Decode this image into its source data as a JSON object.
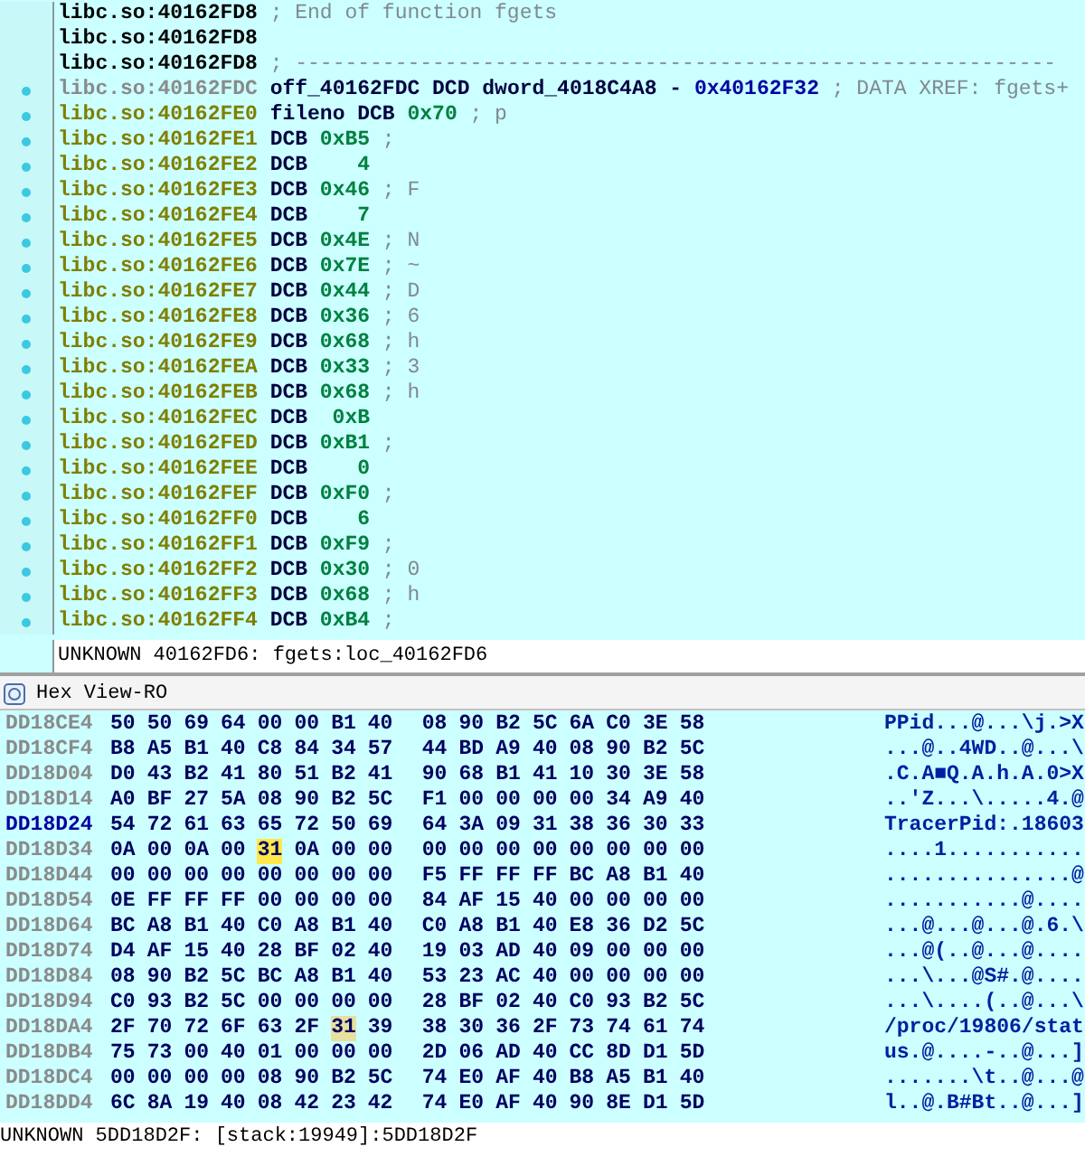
{
  "disassembly": {
    "lines": [
      {
        "addr": "libc.so:40162FD8",
        "color": "#000000",
        "dot": false,
        "tokens": [
          {
            "text": "; End of function fgets",
            "kind": "comment"
          }
        ]
      },
      {
        "addr": "libc.so:40162FD8",
        "color": "#000000",
        "dot": false
      },
      {
        "addr": "libc.so:40162FD8",
        "color": "#000000",
        "dot": false,
        "tokens": [
          {
            "text": "; -------------------------------------------------------------",
            "kind": "comment"
          }
        ]
      },
      {
        "addr": "libc.so:40162FDC",
        "color": "#8a8a8a",
        "dot": true,
        "tokens": [
          {
            "text": "off_40162FDC",
            "kind": "name"
          },
          {
            "text": "DCD",
            "kind": "keyword"
          },
          {
            "text": "dword_4018C4A8",
            "kind": "name"
          },
          {
            "text": "-",
            "kind": "name"
          },
          {
            "text": "0x40162F32",
            "kind": "address"
          },
          {
            "text": "; DATA XREF: fgets+",
            "kind": "comment"
          }
        ]
      },
      {
        "addr": "libc.so:40162FE0",
        "color": "#7f7f00",
        "dot": true,
        "tokens": [
          {
            "text": "fileno",
            "kind": "name"
          },
          {
            "text": "DCB",
            "kind": "keyword"
          },
          {
            "text": "0x70",
            "kind": "number"
          },
          {
            "text": "; p",
            "kind": "comment"
          }
        ]
      },
      {
        "addr": "libc.so:40162FE1",
        "color": "#7f7f00",
        "dot": true,
        "tokens": [
          {
            "text": "DCB",
            "kind": "keyword"
          },
          {
            "text": "0xB5",
            "kind": "number"
          },
          {
            "text": ";",
            "kind": "comment"
          }
        ]
      },
      {
        "addr": "libc.so:40162FE2",
        "color": "#7f7f00",
        "dot": true,
        "tokens": [
          {
            "text": "DCB",
            "kind": "keyword"
          },
          {
            "text": "4",
            "kind": "number"
          }
        ]
      },
      {
        "addr": "libc.so:40162FE3",
        "color": "#7f7f00",
        "dot": true,
        "tokens": [
          {
            "text": "DCB",
            "kind": "keyword"
          },
          {
            "text": "0x46",
            "kind": "number"
          },
          {
            "text": "; F",
            "kind": "comment"
          }
        ]
      },
      {
        "addr": "libc.so:40162FE4",
        "color": "#7f7f00",
        "dot": true,
        "tokens": [
          {
            "text": "DCB",
            "kind": "keyword"
          },
          {
            "text": "7",
            "kind": "number"
          }
        ]
      },
      {
        "addr": "libc.so:40162FE5",
        "color": "#7f7f00",
        "dot": true,
        "tokens": [
          {
            "text": "DCB",
            "kind": "keyword"
          },
          {
            "text": "0x4E",
            "kind": "number"
          },
          {
            "text": "; N",
            "kind": "comment"
          }
        ]
      },
      {
        "addr": "libc.so:40162FE6",
        "color": "#7f7f00",
        "dot": true,
        "tokens": [
          {
            "text": "DCB",
            "kind": "keyword"
          },
          {
            "text": "0x7E",
            "kind": "number"
          },
          {
            "text": "; ~",
            "kind": "comment"
          }
        ]
      },
      {
        "addr": "libc.so:40162FE7",
        "color": "#7f7f00",
        "dot": true,
        "tokens": [
          {
            "text": "DCB",
            "kind": "keyword"
          },
          {
            "text": "0x44",
            "kind": "number"
          },
          {
            "text": "; D",
            "kind": "comment"
          }
        ]
      },
      {
        "addr": "libc.so:40162FE8",
        "color": "#7f7f00",
        "dot": true,
        "tokens": [
          {
            "text": "DCB",
            "kind": "keyword"
          },
          {
            "text": "0x36",
            "kind": "number"
          },
          {
            "text": "; 6",
            "kind": "comment"
          }
        ]
      },
      {
        "addr": "libc.so:40162FE9",
        "color": "#7f7f00",
        "dot": true,
        "tokens": [
          {
            "text": "DCB",
            "kind": "keyword"
          },
          {
            "text": "0x68",
            "kind": "number"
          },
          {
            "text": "; h",
            "kind": "comment"
          }
        ]
      },
      {
        "addr": "libc.so:40162FEA",
        "color": "#7f7f00",
        "dot": true,
        "tokens": [
          {
            "text": "DCB",
            "kind": "keyword"
          },
          {
            "text": "0x33",
            "kind": "number"
          },
          {
            "text": "; 3",
            "kind": "comment"
          }
        ]
      },
      {
        "addr": "libc.so:40162FEB",
        "color": "#7f7f00",
        "dot": true,
        "tokens": [
          {
            "text": "DCB",
            "kind": "keyword"
          },
          {
            "text": "0x68",
            "kind": "number"
          },
          {
            "text": "; h",
            "kind": "comment"
          }
        ]
      },
      {
        "addr": "libc.so:40162FEC",
        "color": "#7f7f00",
        "dot": true,
        "tokens": [
          {
            "text": "DCB",
            "kind": "keyword"
          },
          {
            "text": "0xB",
            "kind": "number"
          }
        ]
      },
      {
        "addr": "libc.so:40162FED",
        "color": "#7f7f00",
        "dot": true,
        "tokens": [
          {
            "text": "DCB",
            "kind": "keyword"
          },
          {
            "text": "0xB1",
            "kind": "number"
          },
          {
            "text": ";",
            "kind": "comment"
          }
        ]
      },
      {
        "addr": "libc.so:40162FEE",
        "color": "#7f7f00",
        "dot": true,
        "tokens": [
          {
            "text": "DCB",
            "kind": "keyword"
          },
          {
            "text": "0",
            "kind": "number"
          }
        ]
      },
      {
        "addr": "libc.so:40162FEF",
        "color": "#7f7f00",
        "dot": true,
        "tokens": [
          {
            "text": "DCB",
            "kind": "keyword"
          },
          {
            "text": "0xF0",
            "kind": "number"
          },
          {
            "text": ";",
            "kind": "comment"
          }
        ]
      },
      {
        "addr": "libc.so:40162FF0",
        "color": "#7f7f00",
        "dot": true,
        "tokens": [
          {
            "text": "DCB",
            "kind": "keyword"
          },
          {
            "text": "6",
            "kind": "number"
          }
        ]
      },
      {
        "addr": "libc.so:40162FF1",
        "color": "#7f7f00",
        "dot": true,
        "tokens": [
          {
            "text": "DCB",
            "kind": "keyword"
          },
          {
            "text": "0xF9",
            "kind": "number"
          },
          {
            "text": ";",
            "kind": "comment"
          }
        ]
      },
      {
        "addr": "libc.so:40162FF2",
        "color": "#7f7f00",
        "dot": true,
        "tokens": [
          {
            "text": "DCB",
            "kind": "keyword"
          },
          {
            "text": "0x30",
            "kind": "number"
          },
          {
            "text": "; 0",
            "kind": "comment"
          }
        ]
      },
      {
        "addr": "libc.so:40162FF3",
        "color": "#7f7f00",
        "dot": true,
        "tokens": [
          {
            "text": "DCB",
            "kind": "keyword"
          },
          {
            "text": "0x68",
            "kind": "number"
          },
          {
            "text": "; h",
            "kind": "comment"
          }
        ]
      },
      {
        "addr": "libc.so:40162FF4",
        "color": "#7f7f00",
        "dot": true,
        "tokens": [
          {
            "text": "DCB",
            "kind": "keyword"
          },
          {
            "text": "0xB4",
            "kind": "number"
          },
          {
            "text": ";",
            "kind": "comment"
          }
        ]
      }
    ],
    "status": "UNKNOWN 40162FD6: fgets:loc_40162FD6"
  },
  "hex_view": {
    "title": "Hex View-RO",
    "rows": [
      {
        "addr": "DD18CE4",
        "current": false,
        "bytes": [
          "50",
          "50",
          "69",
          "64",
          "00",
          "00",
          "B1",
          "40",
          "08",
          "90",
          "B2",
          "5C",
          "6A",
          "C0",
          "3E",
          "58"
        ],
        "ascii": "PPid...@...\\j.>X"
      },
      {
        "addr": "DD18CF4",
        "current": false,
        "bytes": [
          "B8",
          "A5",
          "B1",
          "40",
          "C8",
          "84",
          "34",
          "57",
          "44",
          "BD",
          "A9",
          "40",
          "08",
          "90",
          "B2",
          "5C"
        ],
        "ascii": "...@..4WD..@...\\"
      },
      {
        "addr": "DD18D04",
        "current": false,
        "bytes": [
          "D0",
          "43",
          "B2",
          "41",
          "80",
          "51",
          "B2",
          "41",
          "90",
          "68",
          "B1",
          "41",
          "10",
          "30",
          "3E",
          "58"
        ],
        "ascii": ".C.A■Q.A.h.A.0>X"
      },
      {
        "addr": "DD18D14",
        "current": false,
        "bytes": [
          "A0",
          "BF",
          "27",
          "5A",
          "08",
          "90",
          "B2",
          "5C",
          "F1",
          "00",
          "00",
          "00",
          "00",
          "34",
          "A9",
          "40"
        ],
        "ascii": "..'Z...\\.....4.@"
      },
      {
        "addr": "DD18D24",
        "current": true,
        "bytes": [
          "54",
          "72",
          "61",
          "63",
          "65",
          "72",
          "50",
          "69",
          "64",
          "3A",
          "09",
          "31",
          "38",
          "36",
          "30",
          "33"
        ],
        "ascii": "TracerPid:.18603"
      },
      {
        "addr": "DD18D34",
        "current": false,
        "bytes": [
          "0A",
          "00",
          "0A",
          "00",
          {
            "text": "31",
            "color": "#ffe84a"
          },
          "0A",
          "00",
          "00",
          "00",
          "00",
          "00",
          "00",
          "00",
          "00",
          "00",
          "00"
        ],
        "ascii": "....1..........."
      },
      {
        "addr": "DD18D44",
        "current": false,
        "bytes": [
          "00",
          "00",
          "00",
          "00",
          "00",
          "00",
          "00",
          "00",
          "F5",
          "FF",
          "FF",
          "FF",
          "BC",
          "A8",
          "B1",
          "40"
        ],
        "ascii": "...............@"
      },
      {
        "addr": "DD18D54",
        "current": false,
        "bytes": [
          "0E",
          "FF",
          "FF",
          "FF",
          "00",
          "00",
          "00",
          "00",
          "84",
          "AF",
          "15",
          "40",
          "00",
          "00",
          "00",
          "00"
        ],
        "ascii": "...........@...."
      },
      {
        "addr": "DD18D64",
        "current": false,
        "bytes": [
          "BC",
          "A8",
          "B1",
          "40",
          "C0",
          "A8",
          "B1",
          "40",
          "C0",
          "A8",
          "B1",
          "40",
          "E8",
          "36",
          "D2",
          "5C"
        ],
        "ascii": "...@...@...@.6.\\"
      },
      {
        "addr": "DD18D74",
        "current": false,
        "bytes": [
          "D4",
          "AF",
          "15",
          "40",
          "28",
          "BF",
          "02",
          "40",
          "19",
          "03",
          "AD",
          "40",
          "09",
          "00",
          "00",
          "00"
        ],
        "ascii": "...@(..@...@...."
      },
      {
        "addr": "DD18D84",
        "current": false,
        "bytes": [
          "08",
          "90",
          "B2",
          "5C",
          "BC",
          "A8",
          "B1",
          "40",
          "53",
          "23",
          "AC",
          "40",
          "00",
          "00",
          "00",
          "00"
        ],
        "ascii": "...\\...@S#.@...."
      },
      {
        "addr": "DD18D94",
        "current": false,
        "bytes": [
          "C0",
          "93",
          "B2",
          "5C",
          "00",
          "00",
          "00",
          "00",
          "28",
          "BF",
          "02",
          "40",
          "C0",
          "93",
          "B2",
          "5C"
        ],
        "ascii": "...\\....(..@...\\"
      },
      {
        "addr": "DD18DA4",
        "current": false,
        "bytes": [
          "2F",
          "70",
          "72",
          "6F",
          "63",
          "2F",
          {
            "text": "31",
            "color": "#e8e0a0"
          },
          "39",
          "38",
          "30",
          "36",
          "2F",
          "73",
          "74",
          "61",
          "74"
        ],
        "ascii": "/proc/19806/stat"
      },
      {
        "addr": "DD18DB4",
        "current": false,
        "bytes": [
          "75",
          "73",
          "00",
          "40",
          "01",
          "00",
          "00",
          "00",
          "2D",
          "06",
          "AD",
          "40",
          "CC",
          "8D",
          "D1",
          "5D"
        ],
        "ascii": "us.@....-..@...]"
      },
      {
        "addr": "DD18DC4",
        "current": false,
        "bytes": [
          "00",
          "00",
          "00",
          "00",
          "08",
          "90",
          "B2",
          "5C",
          "74",
          "E0",
          "AF",
          "40",
          "B8",
          "A5",
          "B1",
          "40"
        ],
        "ascii": ".......\\t..@...@"
      },
      {
        "addr": "DD18DD4",
        "current": false,
        "bytes": [
          "6C",
          "8A",
          "19",
          "40",
          "08",
          "42",
          "23",
          "42",
          "74",
          "E0",
          "AF",
          "40",
          "90",
          "8E",
          "D1",
          "5D"
        ],
        "ascii": "l..@.B#Bt..@...]"
      }
    ],
    "status": "UNKNOWN 5DD18D2F: [stack:19949]:5DD18D2F"
  }
}
